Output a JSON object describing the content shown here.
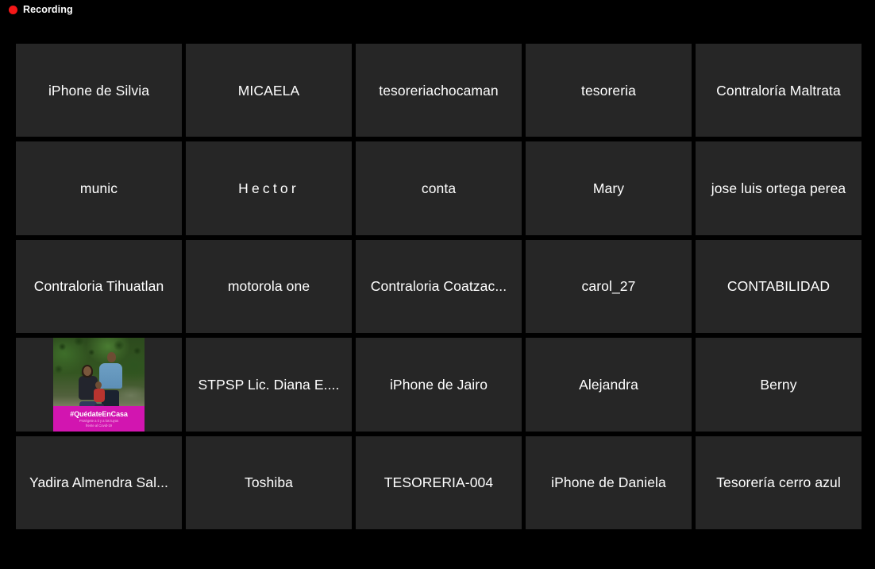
{
  "app": {
    "background_color": "#000000",
    "tile_color": "#262626",
    "accent_color": "#f51818"
  },
  "recording": {
    "label": "Recording",
    "dot_icon": "record-dot-icon",
    "dot_color": "#f51818"
  },
  "gallery": {
    "columns": 5,
    "rows": 5,
    "participants": [
      {
        "name": "iPhone de Silvia",
        "type": "name-only"
      },
      {
        "name": "MICAELA",
        "type": "name-only"
      },
      {
        "name": "tesoreriachocaman",
        "type": "name-only"
      },
      {
        "name": "tesoreria",
        "type": "name-only"
      },
      {
        "name": "Contraloría Maltrata",
        "type": "name-only"
      },
      {
        "name": "munic",
        "type": "name-only"
      },
      {
        "name": "Hector",
        "type": "name-only",
        "letter_spaced": true
      },
      {
        "name": "conta",
        "type": "name-only"
      },
      {
        "name": "Mary",
        "type": "name-only"
      },
      {
        "name": "jose luis ortega perea",
        "type": "name-only"
      },
      {
        "name": "Contraloria Tihuatlan",
        "type": "name-only"
      },
      {
        "name": "motorola one",
        "type": "name-only"
      },
      {
        "name": "Contraloria Coatzac...",
        "type": "name-only"
      },
      {
        "name": "carol_27",
        "type": "name-only"
      },
      {
        "name": "CONTABILIDAD",
        "type": "name-only"
      },
      {
        "name": "",
        "type": "video",
        "photo": {
          "banner_title": "#QuédateEnCasa",
          "banner_subtitle": "Protégete a ti y a los tuyos\nfrente al Covid-19",
          "banner_color": "#d215b0",
          "description": "family-photo-outdoors"
        }
      },
      {
        "name": "STPSP Lic. Diana E....",
        "type": "name-only"
      },
      {
        "name": "iPhone de Jairo",
        "type": "name-only"
      },
      {
        "name": "Alejandra",
        "type": "name-only"
      },
      {
        "name": "Berny",
        "type": "name-only"
      },
      {
        "name": "Yadira Almendra Sal...",
        "type": "name-only"
      },
      {
        "name": "Toshiba",
        "type": "name-only"
      },
      {
        "name": "TESORERIA-004",
        "type": "name-only"
      },
      {
        "name": "iPhone de Daniela",
        "type": "name-only"
      },
      {
        "name": "Tesorería cerro azul",
        "type": "name-only"
      }
    ]
  }
}
